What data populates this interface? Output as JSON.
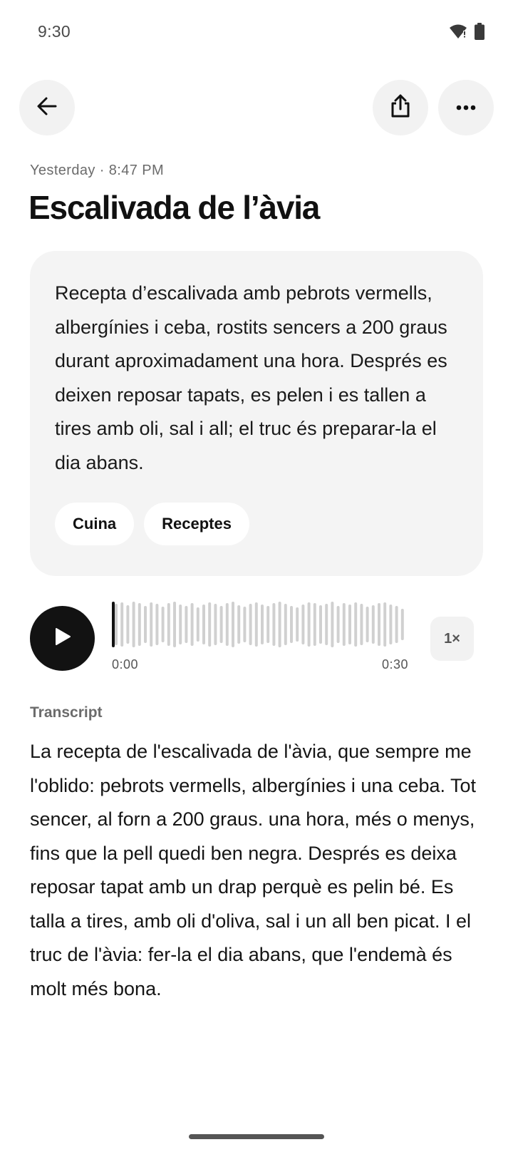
{
  "status_bar": {
    "time": "9:30",
    "icons": [
      "wifi-icon",
      "battery-icon"
    ]
  },
  "toolbar": {
    "back_icon": "arrow-left-icon",
    "share_icon": "share-icon",
    "more_icon": "more-horizontal-icon"
  },
  "note": {
    "timestamp": "Yesterday · 8:47 PM",
    "title": "Escalivada de l’àvia",
    "summary": "Recepta d’escalivada amb pebrots vermells, albergínies i ceba, rostits sencers a 200 graus durant aproximadament una hora. Després es deixen reposar tapats, es pelen i es tallen a tires amb oli, sal i all; el truc és preparar-la el dia abans.",
    "tags": [
      "Cuina",
      "Receptes"
    ]
  },
  "player": {
    "play_icon": "play-icon",
    "current_time": "0:00",
    "duration": "0:30",
    "speed": "1×",
    "progress": 0
  },
  "transcript": {
    "heading": "Transcript",
    "text": "La recepta de l'escalivada de l'àvia, que sempre me l'oblido: pebrots vermells, albergínies i una ceba. Tot sencer, al forn a 200 graus. una hora, més o menys, fins que la pell quedi ben negra. Després es deixa reposar tapat amb un drap perquè es pelin bé. Es talla a tires, amb oli d'oliva, sal i un all ben picat. I el truc de l'àvia: fer-la el dia abans, que l'endemà és molt més bona."
  },
  "colors": {
    "card_background": "#f4f4f4",
    "button_background": "#f2f2f2",
    "play_button": "#121212",
    "waveform_bar": "#d0d0d0",
    "playhead": "#121212"
  }
}
